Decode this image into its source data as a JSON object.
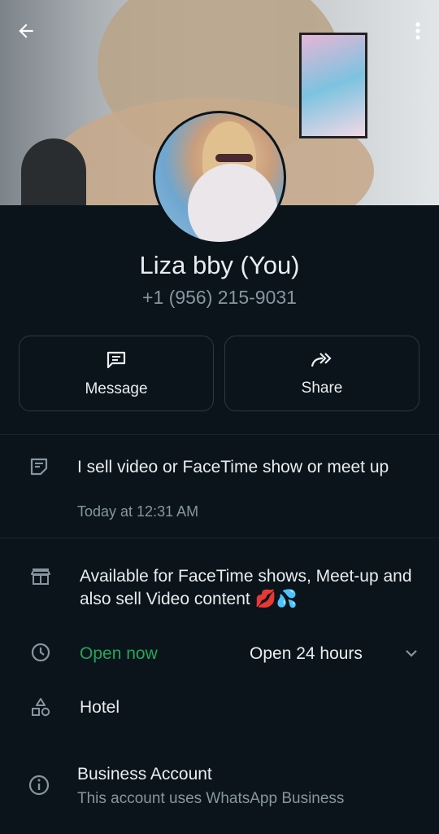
{
  "contact": {
    "name": "Liza bby (You)",
    "phone": "+1 (956) 215-9031"
  },
  "actions": {
    "message_label": "Message",
    "share_label": "Share"
  },
  "about": {
    "text": "I sell video or FaceTime show or meet up",
    "timestamp": "Today at 12:31 AM"
  },
  "business": {
    "description": "Available for FaceTime shows, Meet-up and also sell Video content 💋💦",
    "open_status": "Open now",
    "hours": "Open 24 hours",
    "category": "Hotel",
    "account_title": "Business Account",
    "account_subtitle": "This account uses WhatsApp Business"
  },
  "icons": {
    "back": "back-arrow-icon",
    "menu": "more-vertical-icon",
    "message": "message-icon",
    "share": "share-icon",
    "about": "note-icon",
    "store": "store-icon",
    "clock": "clock-icon",
    "category": "category-shapes-icon",
    "info": "info-icon",
    "chevron": "chevron-down-icon"
  },
  "colors": {
    "background": "#0b141a",
    "open_status": "#25a55a",
    "secondary_text": "#8696a0"
  }
}
